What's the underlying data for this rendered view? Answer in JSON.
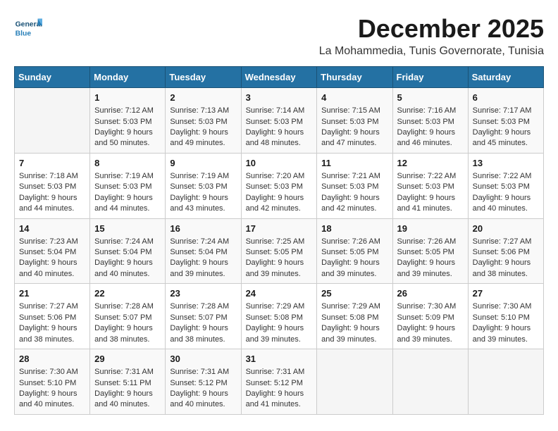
{
  "header": {
    "logo_general": "General",
    "logo_blue": "Blue",
    "title": "December 2025",
    "subtitle": "La Mohammedia, Tunis Governorate, Tunisia"
  },
  "calendar": {
    "columns": [
      "Sunday",
      "Monday",
      "Tuesday",
      "Wednesday",
      "Thursday",
      "Friday",
      "Saturday"
    ],
    "weeks": [
      [
        {
          "day": "",
          "info": ""
        },
        {
          "day": "1",
          "info": "Sunrise: 7:12 AM\nSunset: 5:03 PM\nDaylight: 9 hours and 50 minutes."
        },
        {
          "day": "2",
          "info": "Sunrise: 7:13 AM\nSunset: 5:03 PM\nDaylight: 9 hours and 49 minutes."
        },
        {
          "day": "3",
          "info": "Sunrise: 7:14 AM\nSunset: 5:03 PM\nDaylight: 9 hours and 48 minutes."
        },
        {
          "day": "4",
          "info": "Sunrise: 7:15 AM\nSunset: 5:03 PM\nDaylight: 9 hours and 47 minutes."
        },
        {
          "day": "5",
          "info": "Sunrise: 7:16 AM\nSunset: 5:03 PM\nDaylight: 9 hours and 46 minutes."
        },
        {
          "day": "6",
          "info": "Sunrise: 7:17 AM\nSunset: 5:03 PM\nDaylight: 9 hours and 45 minutes."
        }
      ],
      [
        {
          "day": "7",
          "info": "Sunrise: 7:18 AM\nSunset: 5:03 PM\nDaylight: 9 hours and 44 minutes."
        },
        {
          "day": "8",
          "info": "Sunrise: 7:19 AM\nSunset: 5:03 PM\nDaylight: 9 hours and 44 minutes."
        },
        {
          "day": "9",
          "info": "Sunrise: 7:19 AM\nSunset: 5:03 PM\nDaylight: 9 hours and 43 minutes."
        },
        {
          "day": "10",
          "info": "Sunrise: 7:20 AM\nSunset: 5:03 PM\nDaylight: 9 hours and 42 minutes."
        },
        {
          "day": "11",
          "info": "Sunrise: 7:21 AM\nSunset: 5:03 PM\nDaylight: 9 hours and 42 minutes."
        },
        {
          "day": "12",
          "info": "Sunrise: 7:22 AM\nSunset: 5:03 PM\nDaylight: 9 hours and 41 minutes."
        },
        {
          "day": "13",
          "info": "Sunrise: 7:22 AM\nSunset: 5:03 PM\nDaylight: 9 hours and 40 minutes."
        }
      ],
      [
        {
          "day": "14",
          "info": "Sunrise: 7:23 AM\nSunset: 5:04 PM\nDaylight: 9 hours and 40 minutes."
        },
        {
          "day": "15",
          "info": "Sunrise: 7:24 AM\nSunset: 5:04 PM\nDaylight: 9 hours and 40 minutes."
        },
        {
          "day": "16",
          "info": "Sunrise: 7:24 AM\nSunset: 5:04 PM\nDaylight: 9 hours and 39 minutes."
        },
        {
          "day": "17",
          "info": "Sunrise: 7:25 AM\nSunset: 5:05 PM\nDaylight: 9 hours and 39 minutes."
        },
        {
          "day": "18",
          "info": "Sunrise: 7:26 AM\nSunset: 5:05 PM\nDaylight: 9 hours and 39 minutes."
        },
        {
          "day": "19",
          "info": "Sunrise: 7:26 AM\nSunset: 5:05 PM\nDaylight: 9 hours and 39 minutes."
        },
        {
          "day": "20",
          "info": "Sunrise: 7:27 AM\nSunset: 5:06 PM\nDaylight: 9 hours and 38 minutes."
        }
      ],
      [
        {
          "day": "21",
          "info": "Sunrise: 7:27 AM\nSunset: 5:06 PM\nDaylight: 9 hours and 38 minutes."
        },
        {
          "day": "22",
          "info": "Sunrise: 7:28 AM\nSunset: 5:07 PM\nDaylight: 9 hours and 38 minutes."
        },
        {
          "day": "23",
          "info": "Sunrise: 7:28 AM\nSunset: 5:07 PM\nDaylight: 9 hours and 38 minutes."
        },
        {
          "day": "24",
          "info": "Sunrise: 7:29 AM\nSunset: 5:08 PM\nDaylight: 9 hours and 39 minutes."
        },
        {
          "day": "25",
          "info": "Sunrise: 7:29 AM\nSunset: 5:08 PM\nDaylight: 9 hours and 39 minutes."
        },
        {
          "day": "26",
          "info": "Sunrise: 7:30 AM\nSunset: 5:09 PM\nDaylight: 9 hours and 39 minutes."
        },
        {
          "day": "27",
          "info": "Sunrise: 7:30 AM\nSunset: 5:10 PM\nDaylight: 9 hours and 39 minutes."
        }
      ],
      [
        {
          "day": "28",
          "info": "Sunrise: 7:30 AM\nSunset: 5:10 PM\nDaylight: 9 hours and 40 minutes."
        },
        {
          "day": "29",
          "info": "Sunrise: 7:31 AM\nSunset: 5:11 PM\nDaylight: 9 hours and 40 minutes."
        },
        {
          "day": "30",
          "info": "Sunrise: 7:31 AM\nSunset: 5:12 PM\nDaylight: 9 hours and 40 minutes."
        },
        {
          "day": "31",
          "info": "Sunrise: 7:31 AM\nSunset: 5:12 PM\nDaylight: 9 hours and 41 minutes."
        },
        {
          "day": "",
          "info": ""
        },
        {
          "day": "",
          "info": ""
        },
        {
          "day": "",
          "info": ""
        }
      ]
    ]
  }
}
